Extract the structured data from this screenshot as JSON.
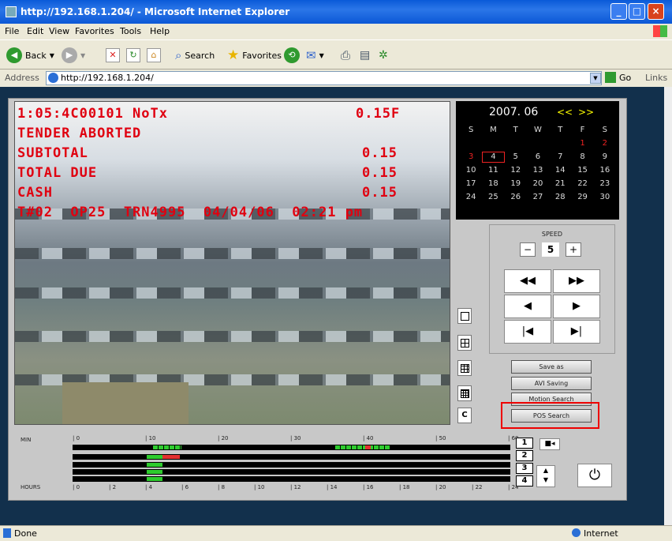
{
  "window": {
    "title": "http://192.168.1.204/ - Microsoft Internet Explorer"
  },
  "menu": [
    "File",
    "Edit",
    "View",
    "Favorites",
    "Tools",
    "Help"
  ],
  "toolbar": {
    "back": "Back",
    "search": "Search",
    "favorites": "Favorites"
  },
  "address": {
    "label": "Address",
    "url": "http://192.168.1.204/",
    "go": "Go",
    "links": "Links"
  },
  "video": {
    "lines": [
      {
        "left": "1:05:4C00101 NoTx",
        "right": "0.15F"
      },
      {
        "left": "TENDER ABORTED",
        "right": ""
      },
      {
        "left": "SUBTOTAL",
        "right": "0.15"
      },
      {
        "left": "TOTAL DUE",
        "right": "0.15"
      },
      {
        "left": "CASH",
        "right": "0.15"
      },
      {
        "left": "T#02  OP25  TRN4995  04/04/06  02:21 pm",
        "right": ""
      }
    ]
  },
  "calendar": {
    "title": "2007. 06",
    "prev": "<<",
    "next": ">>",
    "days": [
      "S",
      "M",
      "T",
      "W",
      "T",
      "F",
      "S"
    ],
    "dates": [
      "",
      "",
      "",
      "",
      "",
      "1",
      "2",
      "3",
      "4",
      "5",
      "6",
      "7",
      "8",
      "9",
      "10",
      "11",
      "12",
      "13",
      "14",
      "15",
      "16",
      "17",
      "18",
      "19",
      "20",
      "21",
      "22",
      "23",
      "24",
      "25",
      "26",
      "27",
      "28",
      "29",
      "30"
    ],
    "selected": "4"
  },
  "controls": {
    "speed_label": "SPEED",
    "speed_value": "5",
    "minus": "−",
    "plus": "+",
    "rewind": "◀◀",
    "ffwd": "▶▶",
    "back": "◀",
    "play": "▶",
    "first": "|◀",
    "last": "▶|"
  },
  "buttons": {
    "save_as": "Save as",
    "avi_saving": "AVI Saving",
    "motion_search": "Motion Search",
    "pos_search": "POS Search",
    "c": "C"
  },
  "timeline": {
    "min_label": "MIN",
    "hours_label": "HOURS",
    "min_ticks": [
      "0",
      "10",
      "20",
      "30",
      "40",
      "50",
      "60"
    ],
    "hour_ticks": [
      "0",
      "2",
      "4",
      "6",
      "8",
      "10",
      "12",
      "14",
      "16",
      "18",
      "20",
      "22",
      "24"
    ],
    "channels": [
      "1",
      "2",
      "3",
      "4"
    ]
  },
  "status": {
    "left": "Done",
    "right": "Internet"
  },
  "colors": {
    "osd": "#e00010",
    "accent_red": "#e00000",
    "rec_green": "#2ecc2e",
    "event_red": "#e33030"
  }
}
